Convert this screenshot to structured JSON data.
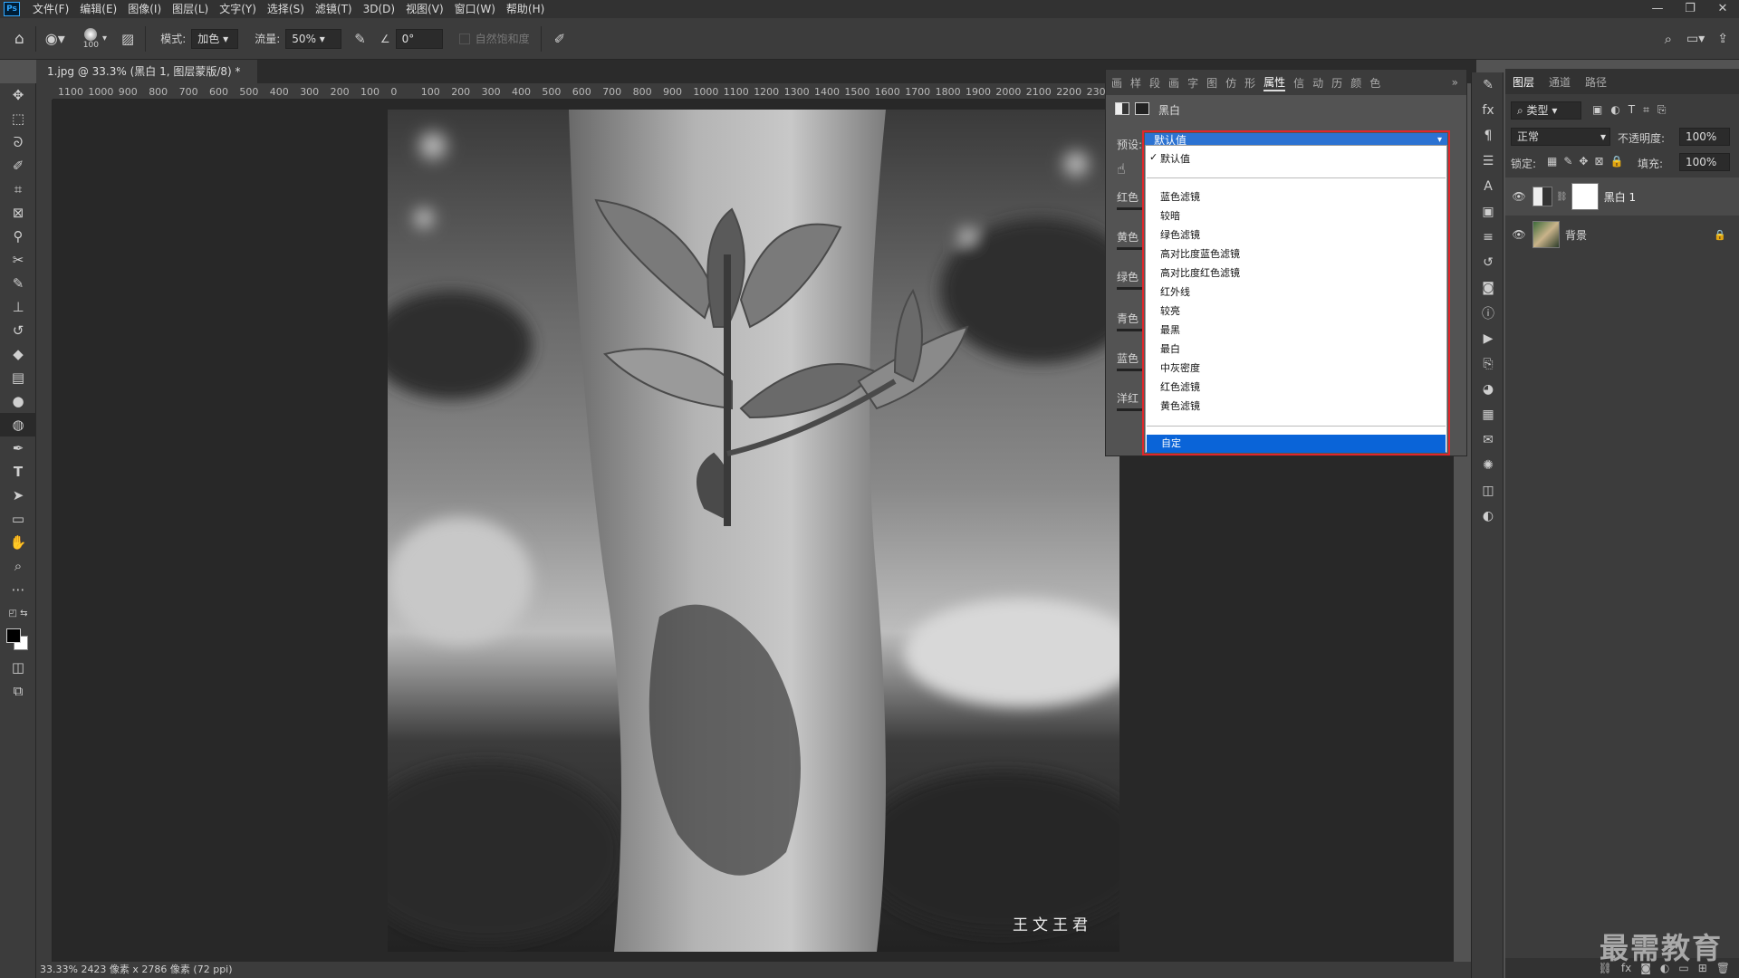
{
  "app": {
    "logo": "Ps"
  },
  "menu": [
    "文件(F)",
    "编辑(E)",
    "图像(I)",
    "图层(L)",
    "文字(Y)",
    "选择(S)",
    "滤镜(T)",
    "3D(D)",
    "视图(V)",
    "窗口(W)",
    "帮助(H)"
  ],
  "window_controls": {
    "minimize": "—",
    "restore": "❐",
    "close": "✕"
  },
  "options": {
    "brush_size": "100",
    "mode_label": "模式:",
    "mode_value": "加色",
    "flow_label": "流量:",
    "flow_value": "50%",
    "angle_value": "0°",
    "vibrance_label": "自然饱和度"
  },
  "document": {
    "tab_title": "1.jpg @ 33.3% (黑白 1, 图层蒙版/8) *",
    "close": "×",
    "signature": "王文王君",
    "status": "33.33%   2423 像素 x 2786 像素 (72 ppi)"
  },
  "ruler_ticks": [
    "1100",
    "1000",
    "900",
    "800",
    "700",
    "600",
    "500",
    "400",
    "300",
    "200",
    "100",
    "0",
    "100",
    "200",
    "300",
    "400",
    "500",
    "600",
    "700",
    "800",
    "900",
    "1000",
    "1100",
    "1200",
    "1300",
    "1400",
    "1500",
    "1600",
    "1700",
    "1800",
    "1900",
    "2000",
    "2100",
    "2200",
    "230"
  ],
  "properties": {
    "tabs": [
      "画",
      "样",
      "段",
      "画",
      "字",
      "图",
      "仿",
      "形",
      "属性",
      "信",
      "动",
      "历",
      "颜",
      "色"
    ],
    "active_tab": "属性",
    "adjustment_name": "黑白",
    "preset_label": "预设:",
    "preset_value": "默认值",
    "channels": [
      "红色",
      "黄色",
      "绿色",
      "青色",
      "蓝色",
      "洋红"
    ]
  },
  "preset_dropdown": {
    "checked": "默认值",
    "items": [
      "蓝色滤镜",
      "较暗",
      "绿色滤镜",
      "高对比度蓝色滤镜",
      "高对比度红色滤镜",
      "红外线",
      "较亮",
      "最黑",
      "最白",
      "中灰密度",
      "红色滤镜",
      "黄色滤镜"
    ],
    "selected": "自定"
  },
  "layers_panel": {
    "tabs": [
      "图层",
      "通道",
      "路径"
    ],
    "filter_kind": "类型",
    "blend_mode": "正常",
    "opacity_label": "不透明度:",
    "opacity_value": "100%",
    "lock_label": "锁定:",
    "fill_label": "填充:",
    "fill_value": "100%",
    "layers": [
      {
        "name": "黑白 1",
        "selected": true
      },
      {
        "name": "背景",
        "selected": false
      }
    ]
  },
  "watermark_brand": "最需教育",
  "colors": {
    "accent_red": "#e0262b",
    "selection_blue": "#0a64d8",
    "panel": "#535353"
  }
}
